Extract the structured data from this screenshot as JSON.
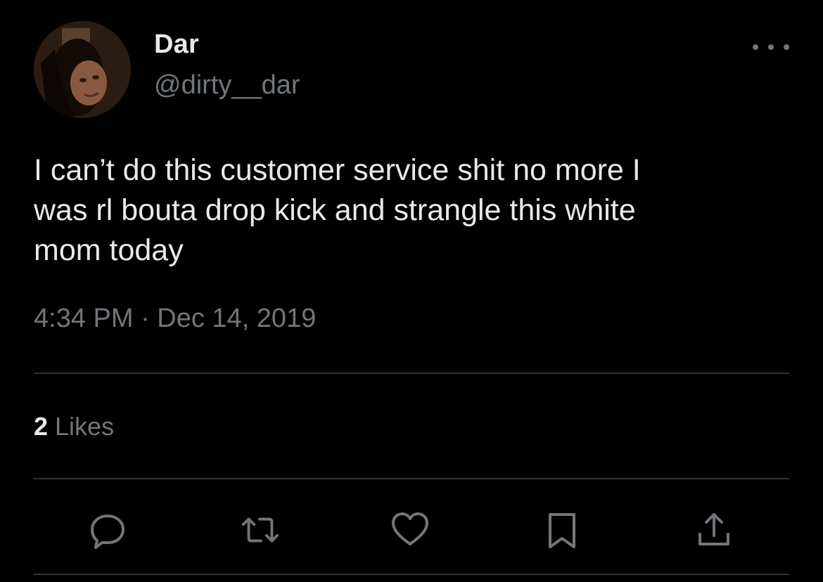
{
  "tweet": {
    "author": {
      "display_name": "Dar",
      "handle": "@dirty__dar"
    },
    "text": "I can’t do this customer service shit no more I\nwas rl bouta drop kick and strangle this white\nmom today",
    "timestamp": "4:34 PM · Dec 14, 2019",
    "likes": {
      "count": "2",
      "label": "Likes"
    }
  },
  "icons": {
    "avatar": "profile-photo",
    "more": "more-horizontal-icon",
    "reply": "reply-icon",
    "retweet": "retweet-icon",
    "like": "heart-icon",
    "bookmark": "bookmark-icon",
    "share": "share-icon"
  },
  "colors": {
    "background": "#000000",
    "primary_text": "#e7e9ea",
    "secondary_text": "#71767b",
    "divider": "#2f3336"
  }
}
